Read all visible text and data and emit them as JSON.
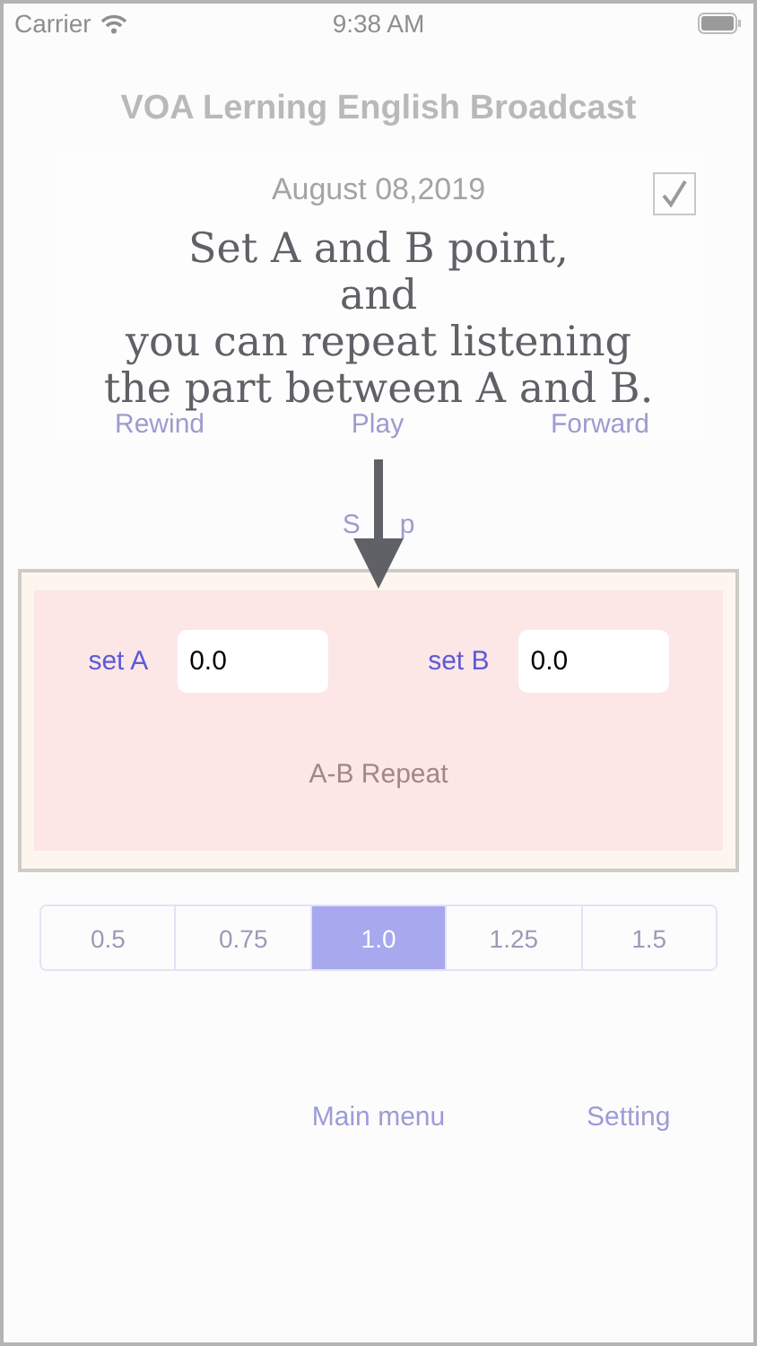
{
  "status_bar": {
    "carrier": "Carrier",
    "time": "9:38 AM"
  },
  "title": "VOA Lerning English Broadcast",
  "player": {
    "date": "August 08,2019",
    "checked": true,
    "controls": [
      "Rewind",
      "Play",
      "Forward"
    ],
    "stop_parts": [
      "S",
      "p"
    ]
  },
  "tutorial": {
    "lines": [
      "Set A and B point,",
      "and",
      "you can repeat listening",
      "the part between A and B."
    ]
  },
  "ab_repeat": {
    "fields": [
      {
        "label": "set A",
        "value": "0.0"
      },
      {
        "label": "set B",
        "value": "0.0"
      }
    ],
    "button": "A-B Repeat"
  },
  "speeds": [
    {
      "label": "0.5",
      "selected": false
    },
    {
      "label": "0.75",
      "selected": false
    },
    {
      "label": "1.0",
      "selected": true
    },
    {
      "label": "1.25",
      "selected": false
    },
    {
      "label": "1.5",
      "selected": false
    }
  ],
  "bottom_links": [
    "Main menu",
    "Setting"
  ]
}
